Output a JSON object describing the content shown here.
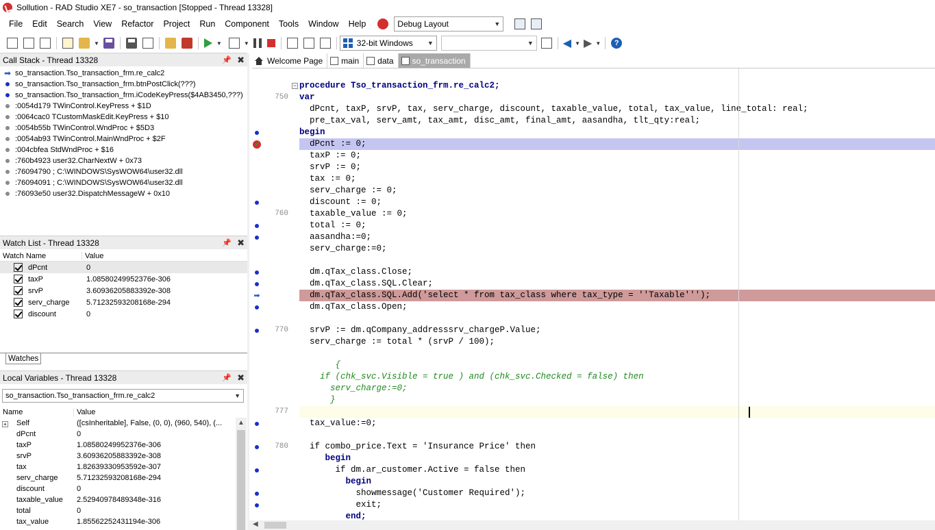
{
  "window": {
    "title": "Sollution - RAD Studio XE7 - so_transaction [Stopped - Thread 13328]"
  },
  "menu": {
    "items": [
      "File",
      "Edit",
      "Search",
      "View",
      "Refactor",
      "Project",
      "Run",
      "Component",
      "Tools",
      "Window",
      "Help"
    ],
    "layout_combo": "Debug Layout"
  },
  "toolbar": {
    "platform": "32-bit Windows",
    "config": ""
  },
  "call_stack": {
    "title": "Call Stack - Thread 13328",
    "rows": [
      {
        "marker": "arrow",
        "text": "so_transaction.Tso_transaction_frm.re_calc2"
      },
      {
        "marker": "blue",
        "text": "so_transaction.Tso_transaction_frm.btnPostClick(???)"
      },
      {
        "marker": "blue",
        "text": "so_transaction.Tso_transaction_frm.iCodeKeyPress($4AB3450,???)"
      },
      {
        "marker": "gray",
        "text": ":0054d179 TWinControl.KeyPress + $1D"
      },
      {
        "marker": "gray",
        "text": ":0064cac0 TCustomMaskEdit.KeyPress + $10"
      },
      {
        "marker": "gray",
        "text": ":0054b55b TWinControl.WndProc + $5D3"
      },
      {
        "marker": "gray",
        "text": ":0054ab93 TWinControl.MainWndProc + $2F"
      },
      {
        "marker": "gray",
        "text": ":004cbfea StdWndProc + $16"
      },
      {
        "marker": "gray",
        "text": ":760b4923 user32.CharNextW + 0x73"
      },
      {
        "marker": "gray",
        "text": ":76094790 ; C:\\WINDOWS\\SysWOW64\\user32.dll"
      },
      {
        "marker": "gray",
        "text": ":76094091 ; C:\\WINDOWS\\SysWOW64\\user32.dll"
      },
      {
        "marker": "gray",
        "text": ":76093e50 user32.DispatchMessageW + 0x10"
      }
    ]
  },
  "watch_list": {
    "title": "Watch List - Thread 13328",
    "col_name": "Watch Name",
    "col_value": "Value",
    "rows": [
      {
        "name": "dPcnt",
        "value": "0"
      },
      {
        "name": "taxP",
        "value": "1.08580249952376e-306"
      },
      {
        "name": "srvP",
        "value": "3.60936205883392e-308"
      },
      {
        "name": "serv_charge",
        "value": "5.71232593208168e-294"
      },
      {
        "name": "discount",
        "value": "0"
      }
    ],
    "tab": "Watches"
  },
  "locals": {
    "title": "Local Variables - Thread 13328",
    "combo": "so_transaction.Tso_transaction_frm.re_calc2",
    "col_name": "Name",
    "col_value": "Value",
    "rows": [
      {
        "name": "Self",
        "value": "([csInheritable], False, (0, 0), (960, 540), (..."
      },
      {
        "name": "dPcnt",
        "value": "0"
      },
      {
        "name": "taxP",
        "value": "1.08580249952376e-306"
      },
      {
        "name": "srvP",
        "value": "3.60936205883392e-308"
      },
      {
        "name": "tax",
        "value": "1.82639330953592e-307"
      },
      {
        "name": "serv_charge",
        "value": "5.71232593208168e-294"
      },
      {
        "name": "discount",
        "value": "0"
      },
      {
        "name": "taxable_value",
        "value": "2.52940978489348e-316"
      },
      {
        "name": "total",
        "value": "0"
      },
      {
        "name": "tax_value",
        "value": "1.85562252431194e-306"
      }
    ]
  },
  "editor": {
    "tabs": [
      "Welcome Page",
      "main",
      "data",
      "so_transaction"
    ],
    "active_tab": "so_transaction",
    "line_numbers": {
      "l750": "750",
      "l760": "760",
      "l770": "770",
      "l777": "777",
      "l780": "780"
    },
    "code": {
      "c0": "procedure Tso_transaction_frm.re_calc2;",
      "c1": "var",
      "c2": "  dPcnt, taxP, srvP, tax, serv_charge, discount, taxable_value, total, tax_value, line_total: real;",
      "c3": "  pre_tax_val, serv_amt, tax_amt, disc_amt, final_amt, aasandha, tlt_qty:real;",
      "c4": "begin",
      "c5": "  dPcnt := 0;",
      "c6": "  taxP := 0;",
      "c7": "  srvP := 0;",
      "c8": "  tax := 0;",
      "c9": "  serv_charge := 0;",
      "c10": "  discount := 0;",
      "c11": "  taxable_value := 0;",
      "c12": "  total := 0;",
      "c13": "  aasandha:=0;",
      "c14": "  serv_charge:=0;",
      "c16": "  dm.qTax_class.Close;",
      "c17": "  dm.qTax_class.SQL.Clear;",
      "c18": "  dm.qTax_class.SQL.Add('select * from tax_class where tax_type = ''Taxable''');",
      "c19": "  dm.qTax_class.Open;",
      "c21": "  srvP := dm.qCompany_addresssrv_chargeP.Value;",
      "c22": "  serv_charge := total * (srvP / 100);",
      "c24": "       {",
      "c25": "    if (chk_svc.Visible = true ) and (chk_svc.Checked = false) then",
      "c26": "      serv_charge:=0;",
      "c27": "      }",
      "c29": "  tax_value:=0;",
      "c31": "  if combo_price.Text = 'Insurance Price' then",
      "c32": "     begin",
      "c33": "       if dm.ar_customer.Active = false then",
      "c34": "         begin",
      "c35": "           showmessage('Customer Required');",
      "c36": "           exit;",
      "c37": "         end;"
    }
  }
}
